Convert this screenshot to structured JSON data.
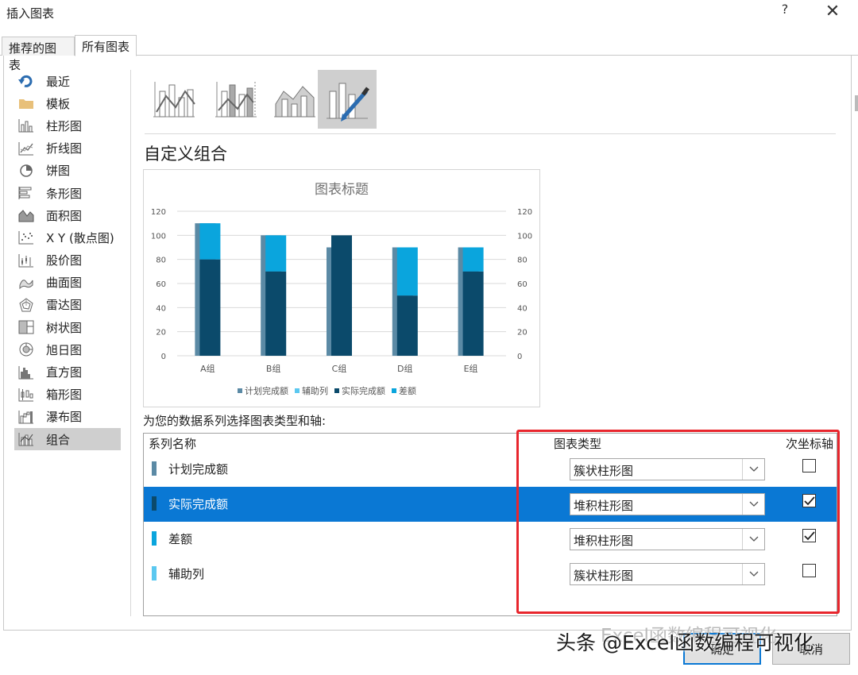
{
  "window": {
    "title": "插入图表",
    "help": "?",
    "close": "✕"
  },
  "tabs": [
    {
      "label": "推荐的图表"
    },
    {
      "label": "所有图表"
    }
  ],
  "sidebar": {
    "items": [
      {
        "label": "最近",
        "icon": "recent-icon"
      },
      {
        "label": "模板",
        "icon": "folder-icon"
      },
      {
        "label": "柱形图",
        "icon": "column-chart-icon"
      },
      {
        "label": "折线图",
        "icon": "line-chart-icon"
      },
      {
        "label": "饼图",
        "icon": "pie-chart-icon"
      },
      {
        "label": "条形图",
        "icon": "bar-chart-icon"
      },
      {
        "label": "面积图",
        "icon": "area-chart-icon"
      },
      {
        "label": "X Y (散点图)",
        "icon": "scatter-chart-icon"
      },
      {
        "label": "股价图",
        "icon": "stock-chart-icon"
      },
      {
        "label": "曲面图",
        "icon": "surface-chart-icon"
      },
      {
        "label": "雷达图",
        "icon": "radar-chart-icon"
      },
      {
        "label": "树状图",
        "icon": "treemap-chart-icon"
      },
      {
        "label": "旭日图",
        "icon": "sunburst-chart-icon"
      },
      {
        "label": "直方图",
        "icon": "histogram-chart-icon"
      },
      {
        "label": "箱形图",
        "icon": "box-chart-icon"
      },
      {
        "label": "瀑布图",
        "icon": "waterfall-chart-icon"
      },
      {
        "label": "组合",
        "icon": "combo-chart-icon",
        "active": true
      }
    ]
  },
  "combo_types": [
    {
      "icon": "clustered-column-line-icon"
    },
    {
      "icon": "clustered-column-line-secondary-icon"
    },
    {
      "icon": "stacked-area-clustered-column-icon"
    },
    {
      "icon": "custom-combination-icon",
      "active": true
    }
  ],
  "section_title": "自定义组合",
  "chart_data": {
    "type": "bar",
    "title": "图表标题",
    "categories": [
      "A组",
      "B组",
      "C组",
      "D组",
      "E组"
    ],
    "series": [
      {
        "name": "计划完成额",
        "values": [
          110,
          100,
          90,
          90,
          90
        ],
        "color": "#5b8aa5",
        "axis": "primary",
        "stack": false
      },
      {
        "name": "辅助列",
        "values": [
          0,
          0,
          0,
          0,
          0
        ],
        "color": "#5bc8f0",
        "axis": "primary",
        "stack": false
      },
      {
        "name": "实际完成额",
        "values": [
          80,
          70,
          100,
          50,
          70
        ],
        "color": "#0b4a6b",
        "axis": "secondary",
        "stack": true
      },
      {
        "name": "差额",
        "values": [
          30,
          30,
          0,
          40,
          20
        ],
        "color": "#0aa5dd",
        "axis": "secondary",
        "stack": true
      }
    ],
    "ylim": [
      0,
      120
    ],
    "yticks": [
      0,
      20,
      40,
      60,
      80,
      100,
      120
    ],
    "y2lim": [
      0,
      120
    ],
    "y2ticks": [
      0,
      20,
      40,
      60,
      80,
      100,
      120
    ],
    "grid": true,
    "legend": "bottom"
  },
  "series_prompt": "为您的数据系列选择图表类型和轴:",
  "table": {
    "headers": {
      "name": "系列名称",
      "type": "图表类型",
      "secondary": "次坐标轴"
    },
    "rows": [
      {
        "name": "计划完成额",
        "type": "簇状柱形图",
        "secondary": false,
        "swatch": "#5b8aa5",
        "selected": false
      },
      {
        "name": "实际完成额",
        "type": "堆积柱形图",
        "secondary": true,
        "swatch": "#0b4a6b",
        "selected": true
      },
      {
        "name": "差额",
        "type": "堆积柱形图",
        "secondary": true,
        "swatch": "#0aa5dd",
        "selected": false
      },
      {
        "name": "辅助列",
        "type": "簇状柱形图",
        "secondary": false,
        "swatch": "#5bc8f0",
        "selected": false
      }
    ]
  },
  "buttons": {
    "ok": "确定",
    "cancel": "取消"
  },
  "watermark": "头条 @Excel函数编程可视化",
  "watermark_faint": "Excel函数编程可视化"
}
